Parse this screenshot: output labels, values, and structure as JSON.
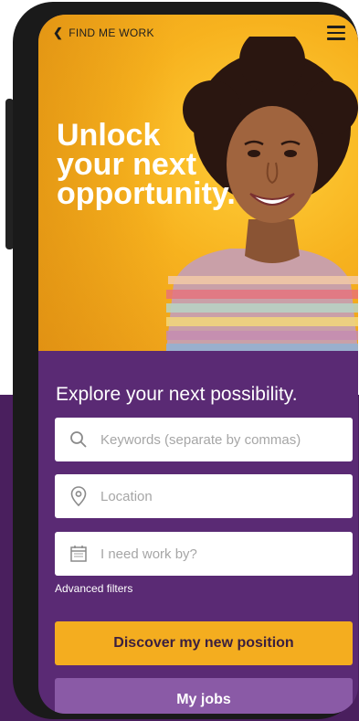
{
  "header": {
    "back_label": "FIND ME WORK"
  },
  "hero": {
    "headline_line1": "Unlock",
    "headline_line2": "your next",
    "headline_line3": "opportunity."
  },
  "search": {
    "title": "Explore your next possibility.",
    "keywords_placeholder": "Keywords (separate by commas)",
    "location_placeholder": "Location",
    "date_placeholder": "I need work by?",
    "advanced_filters": "Advanced filters"
  },
  "actions": {
    "discover_label": "Discover my new position",
    "my_jobs_label": "My jobs"
  },
  "colors": {
    "hero_yellow": "#f7b21e",
    "panel_purple": "#5a2a74",
    "primary_button": "#f4ad1f",
    "secondary_button": "#8a5aa6"
  },
  "icons": {
    "back": "chevron-left-icon",
    "menu": "hamburger-menu-icon",
    "keywords": "search-icon",
    "location": "map-pin-icon",
    "date": "calendar-icon"
  }
}
